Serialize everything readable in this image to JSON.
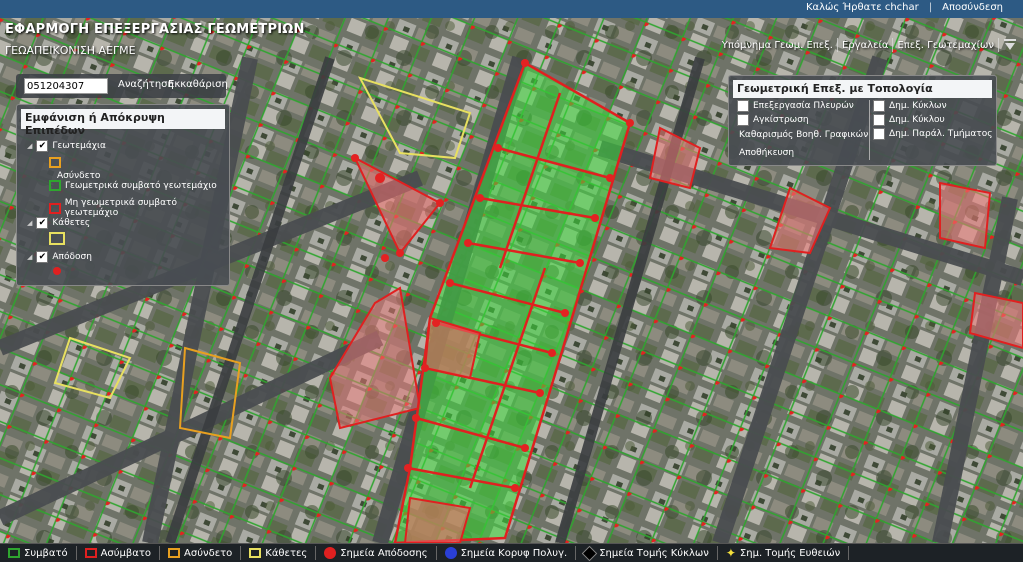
{
  "header": {
    "welcome": "Καλώς Ήρθατε chchar",
    "logout": "Αποσύνδεση",
    "app_title": "ΕΦΑΡΜΟΓΗ ΕΠΕΞΕΡΓΑΣΙΑΣ ΓΕΩΜΕΤΡΙΩΝ",
    "subtitle": "ΓΕΩΑΠΕΙΚΟΝΙΣΗ ΑΕΓΜΕ"
  },
  "menu": {
    "items": [
      "Υπόμνημα Γεωμ. Επεξ.",
      "Εργαλεία",
      "Επεξ. Γεωτεμαχίων"
    ]
  },
  "search": {
    "value": "051204307",
    "search_label": "Αναζήτηση",
    "clear_label": "Εκκαθάριση"
  },
  "layers_panel": {
    "title": "Εμφάνιση ή Απόκρυψη Επιπέδων",
    "groups": [
      {
        "label": "Γεωτεμάχια",
        "checked": true
      },
      {
        "label": "Κάθετες",
        "checked": true
      },
      {
        "label": "Απόδοση",
        "checked": true
      }
    ],
    "sublayers": [
      {
        "label": "Ασύνδετο",
        "color": "#e8a020"
      },
      {
        "label": "Γεωμετρικά συμβατό γεωτεμάχιο",
        "color": "#2fa52f"
      },
      {
        "label": "Μη γεωμετρικά συμβατό γεωτεμάχιο",
        "color": "#e02020"
      }
    ],
    "kathetes_color": "#e8e060",
    "apodosi_color": "#e02020"
  },
  "topology_panel": {
    "title": "Γεωμετρική Επεξ. με Τοπολογία",
    "left": [
      {
        "label": "Επεξεργασία Πλευρών",
        "type": "checkbox"
      },
      {
        "label": "Αγκίστρωση",
        "type": "checkbox"
      },
      {
        "label": "Καθαρισμός Βοηθ. Γραφικών",
        "type": "action"
      },
      {
        "label": "Αποθήκευση",
        "type": "action"
      }
    ],
    "right": [
      {
        "label": "Δημ. Κύκλων",
        "type": "checkbox"
      },
      {
        "label": "Δημ. Κύκλου",
        "type": "checkbox"
      },
      {
        "label": "Δημ. Παράλ. Τμήματος",
        "type": "checkbox"
      }
    ]
  },
  "legend": [
    {
      "label": "Συμβατό",
      "color": "#2fa52f",
      "kind": "box"
    },
    {
      "label": "Ασύμβατο",
      "color": "#e02020",
      "kind": "box"
    },
    {
      "label": "Ασύνδετο",
      "color": "#e8a020",
      "kind": "box"
    },
    {
      "label": "Κάθετες",
      "color": "#e8e060",
      "kind": "box"
    },
    {
      "label": "Σημεία Απόδοσης",
      "color": "#e02020",
      "kind": "dot"
    },
    {
      "label": "Σημεία Κορυφ Πολυγ.",
      "color": "#2a3fd6",
      "kind": "dot"
    },
    {
      "label": "Σημεία Τομής Κύκλων",
      "color": "#000000",
      "kind": "diamond"
    },
    {
      "label": "Σημ. Τομής Ευθειών",
      "color": "#f5e13c",
      "kind": "star"
    }
  ]
}
